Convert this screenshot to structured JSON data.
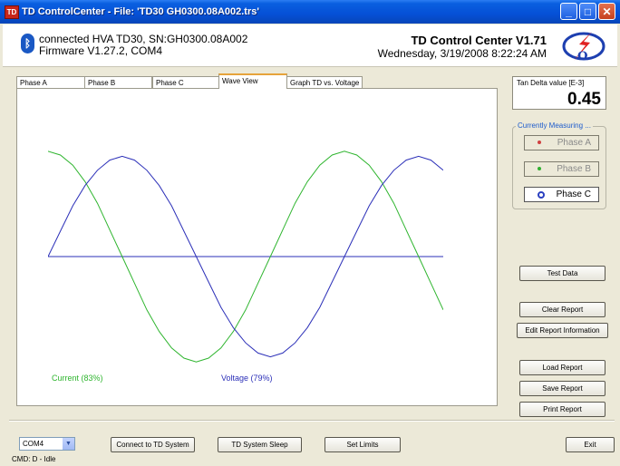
{
  "window": {
    "title": "TD ControlCenter - File: 'TD30 GH0300.08A002.trs'"
  },
  "header": {
    "connection": "connected HVA TD30, SN:GH0300.08A002",
    "firmware": "Firmware V1.27.2, COM4",
    "app_name": "TD Control Center V1.71",
    "datetime": "Wednesday, 3/19/2008 8:22:24 AM"
  },
  "tabs": [
    {
      "label": "Phase A",
      "active": false
    },
    {
      "label": "Phase B",
      "active": false
    },
    {
      "label": "Phase C",
      "active": false
    },
    {
      "label": "Wave View",
      "active": true
    },
    {
      "label": "Graph TD vs. Voltage",
      "active": false
    }
  ],
  "tan_delta": {
    "label": "Tan Delta value [E-3]",
    "value": "0.45"
  },
  "currently_measuring": {
    "title": "Currently Measuring ...",
    "phases": [
      {
        "label": "Phase A",
        "active": false,
        "color": "#d04040"
      },
      {
        "label": "Phase B",
        "active": false,
        "color": "#30b030"
      },
      {
        "label": "Phase C",
        "active": true,
        "color": "#2a3fc0"
      }
    ]
  },
  "side_buttons": {
    "test_data": "Test Data",
    "clear_report": "Clear Report",
    "edit_report": "Edit Report Information",
    "load_report": "Load Report",
    "save_report": "Save Report",
    "print_report": "Print Report"
  },
  "bottom": {
    "com_port": "COM4",
    "connect": "Connect to TD System",
    "sleep": "TD System Sleep",
    "limits": "Set Limits",
    "exit": "Exit"
  },
  "status": "CMD: D - Idle",
  "chart_data": {
    "type": "line",
    "title": "",
    "xlabel": "",
    "ylabel": "",
    "grid": false,
    "x": [
      0,
      15,
      30,
      45,
      60,
      75,
      90,
      105,
      120,
      135,
      150,
      165,
      180,
      195,
      210,
      225,
      240,
      255,
      270,
      285,
      300,
      315,
      330,
      345,
      360,
      375,
      390,
      405,
      420,
      435,
      450,
      465,
      480
    ],
    "ylim": [
      -1,
      1
    ],
    "series": [
      {
        "name": "Current (83%)",
        "color": "#2fb52f",
        "values": [
          0.83,
          0.8,
          0.72,
          0.59,
          0.42,
          0.21,
          0,
          -0.21,
          -0.42,
          -0.59,
          -0.72,
          -0.8,
          -0.83,
          -0.8,
          -0.72,
          -0.59,
          -0.42,
          -0.21,
          0,
          0.21,
          0.42,
          0.59,
          0.72,
          0.8,
          0.83,
          0.8,
          0.72,
          0.59,
          0.42,
          0.21,
          0,
          -0.21,
          -0.42
        ]
      },
      {
        "name": "Voltage (79%)",
        "color": "#2b2fb8",
        "values": [
          0,
          0.2,
          0.4,
          0.56,
          0.68,
          0.76,
          0.79,
          0.76,
          0.68,
          0.56,
          0.4,
          0.2,
          0,
          -0.2,
          -0.4,
          -0.56,
          -0.68,
          -0.76,
          -0.79,
          -0.76,
          -0.68,
          -0.56,
          -0.4,
          -0.2,
          0,
          0.2,
          0.4,
          0.56,
          0.68,
          0.76,
          0.79,
          0.76,
          0.68
        ]
      }
    ]
  }
}
